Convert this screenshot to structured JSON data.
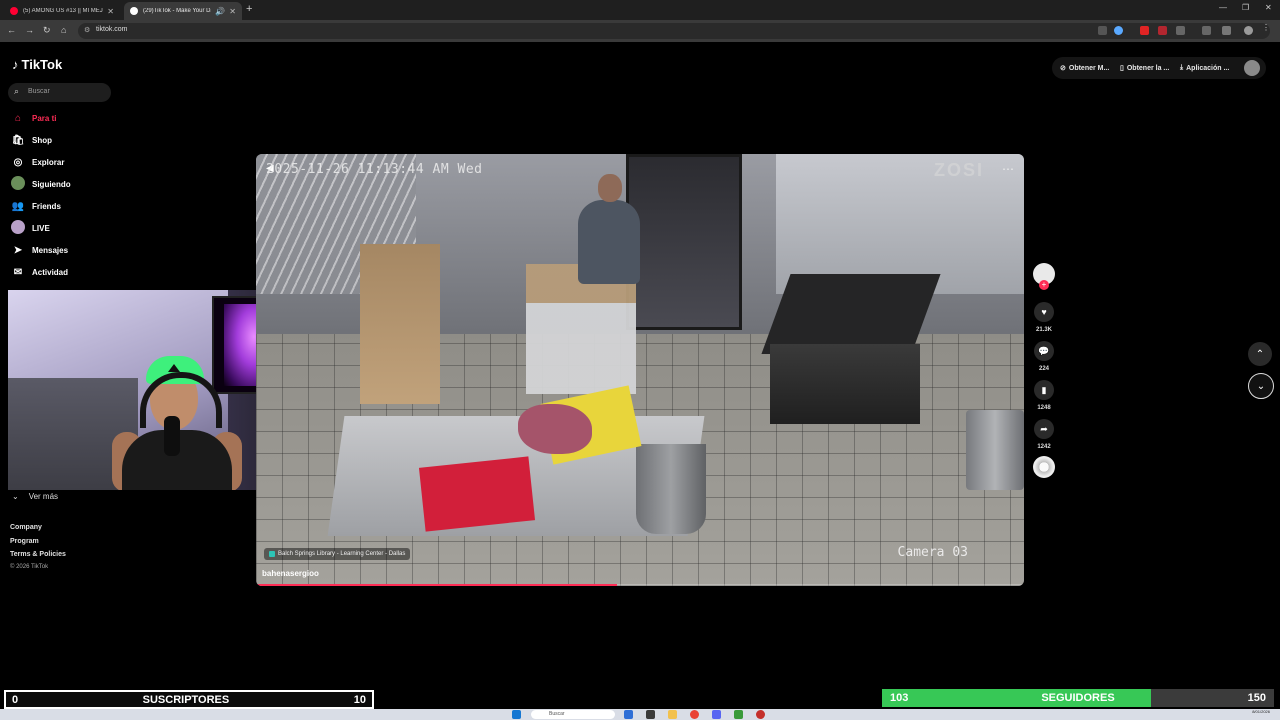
{
  "browser": {
    "tabs": [
      {
        "title": "(5) AMONG US #13 || MI MEJOR",
        "favicon_color": "#ff0033"
      },
      {
        "title": "(29)TikTok - Make Your Day",
        "favicon_color": "#ffffff"
      }
    ],
    "url": "tiktok.com"
  },
  "tiktok": {
    "logo": "TikTok",
    "search_placeholder": "Buscar",
    "nav": [
      {
        "label": "Para ti",
        "icon": "home-icon",
        "active": true
      },
      {
        "label": "Shop",
        "icon": "shop-icon"
      },
      {
        "label": "Explorar",
        "icon": "compass-icon"
      },
      {
        "label": "Siguiendo",
        "icon": "following-avatar-icon"
      },
      {
        "label": "Friends",
        "icon": "friends-icon"
      },
      {
        "label": "LIVE",
        "icon": "live-icon"
      },
      {
        "label": "Mensajes",
        "icon": "send-icon"
      },
      {
        "label": "Actividad",
        "icon": "inbox-icon"
      }
    ],
    "ver_mas": "Ver más",
    "footer_links": [
      "Company",
      "Program",
      "Terms & Policies"
    ],
    "copyright": "© 2026 TikTok",
    "header_actions": [
      "Obtener M...",
      "Obtener la ...",
      "Aplicación ..."
    ]
  },
  "video": {
    "timestamp": "2025-11-26  11:13:44 AM Wed",
    "brand": "ZOSI",
    "camera_label": "Camera 03",
    "location": "Balch Springs Library - Learning Center - Dallas",
    "username": "bahenasergioo",
    "progress": 0.47
  },
  "actions": {
    "likes": "21.3K",
    "comments": "224",
    "saves": "1248",
    "shares": "1242"
  },
  "stream_overlay": {
    "subs_current": "0",
    "subs_label": "SUSCRIPTORES",
    "subs_goal": "10",
    "followers_current": "103",
    "followers_label": "SEGUIDORES",
    "followers_goal": "150",
    "followers_progress": 0.687,
    "followers_color": "#37c856"
  },
  "taskbar": {
    "search_placeholder": "Buscar",
    "date": "8/01/2026"
  },
  "colors": {
    "accent": "#fe2c55",
    "background": "#000000"
  }
}
